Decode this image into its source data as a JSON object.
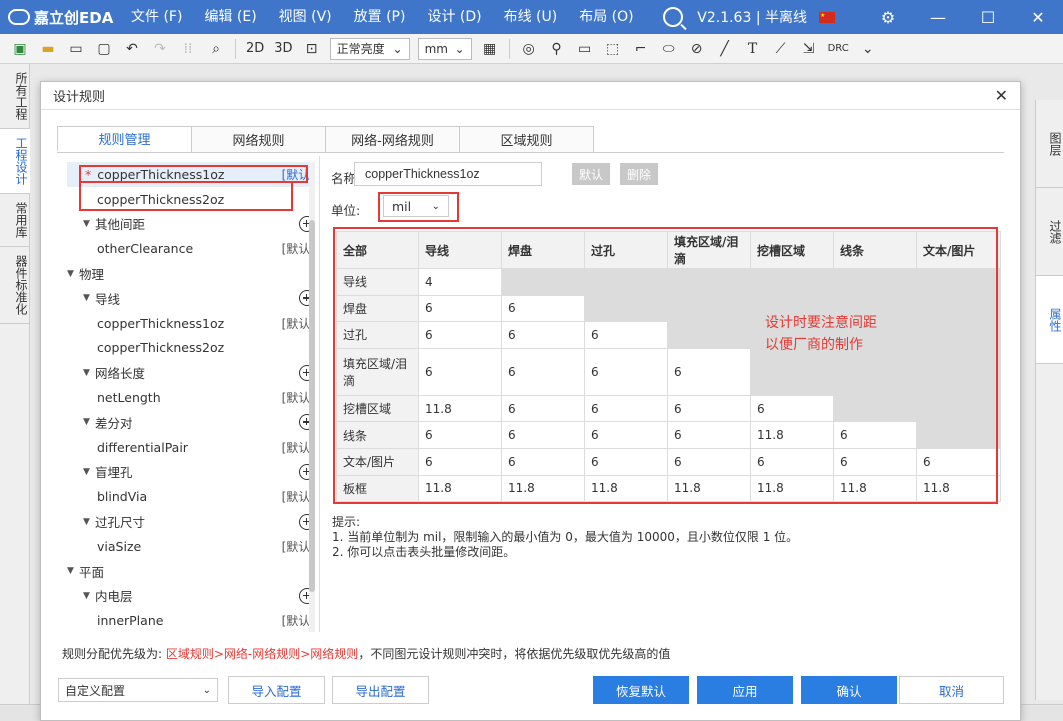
{
  "app": {
    "logo_text": "嘉立创EDA",
    "menu": [
      "文件 (F)",
      "编辑 (E)",
      "视图 (V)",
      "放置 (P)",
      "设计 (D)",
      "布线 (U)",
      "布局 (O)"
    ],
    "version": "V2.1.63 | 半离线",
    "window_controls": [
      "—",
      "☐",
      "✕"
    ]
  },
  "toolbar": {
    "text_2d": "2D",
    "text_3d": "3D",
    "brightness": "正常亮度",
    "unit": "mm",
    "drc": "DRC",
    "icons": [
      "new-icon",
      "open-icon",
      "save-icon",
      "save-all-icon",
      "undo-icon",
      "redo-icon",
      "grid-icon",
      "find-icon",
      "zoom-fit-icon",
      "target-icon",
      "pin-icon",
      "rect-icon",
      "select-icon",
      "polyline-icon",
      "ellipse-icon",
      "circle-slash-icon",
      "line-icon",
      "text-icon",
      "measure-icon",
      "import-icon"
    ]
  },
  "left_nav": [
    "所有工程",
    "工程设计",
    "常用库",
    "器件标准化"
  ],
  "right_nav": [
    "图层",
    "过滤",
    "属性"
  ],
  "dialog": {
    "title": "设计规则",
    "close": "✕",
    "tabs": [
      "规则管理",
      "网络规则",
      "网络-网络规则",
      "区域规则"
    ],
    "tree": [
      {
        "type": "item",
        "indent": 1,
        "label": "copperThickness1oz",
        "star": "*",
        "def": "[默认]",
        "blue": true,
        "selected": true
      },
      {
        "type": "item",
        "indent": 1,
        "label": "copperThickness2oz",
        "def": ""
      },
      {
        "type": "group",
        "indent": 1,
        "label": "其他间距",
        "add": true
      },
      {
        "type": "item",
        "indent": 1,
        "label": "otherClearance",
        "def": "[默认]"
      },
      {
        "type": "group",
        "indent": 0,
        "label": "物理"
      },
      {
        "type": "group",
        "indent": 1,
        "label": "导线",
        "add": true
      },
      {
        "type": "item",
        "indent": 1,
        "label": "copperThickness1oz",
        "def": "[默认]"
      },
      {
        "type": "item",
        "indent": 1,
        "label": "copperThickness2oz",
        "def": ""
      },
      {
        "type": "group",
        "indent": 1,
        "label": "网络长度",
        "add": true
      },
      {
        "type": "item",
        "indent": 1,
        "label": "netLength",
        "def": "[默认]"
      },
      {
        "type": "group",
        "indent": 1,
        "label": "差分对",
        "add": true
      },
      {
        "type": "item",
        "indent": 1,
        "label": "differentialPair",
        "def": "[默认]"
      },
      {
        "type": "group",
        "indent": 1,
        "label": "盲埋孔",
        "add": true
      },
      {
        "type": "item",
        "indent": 1,
        "label": "blindVia",
        "def": "[默认]"
      },
      {
        "type": "group",
        "indent": 1,
        "label": "过孔尺寸",
        "add": true
      },
      {
        "type": "item",
        "indent": 1,
        "label": "viaSize",
        "def": "[默认]"
      },
      {
        "type": "group",
        "indent": 0,
        "label": "平面"
      },
      {
        "type": "group",
        "indent": 1,
        "label": "内电层",
        "add": true
      },
      {
        "type": "item",
        "indent": 1,
        "label": "innerPlane",
        "def": "[默认]"
      }
    ],
    "name_label": "名称:",
    "name_value": "copperThickness1oz",
    "btn_default": "默认",
    "btn_delete": "删除",
    "unit_label": "单位:",
    "unit_value": "mil",
    "table": {
      "headers": [
        "全部",
        "导线",
        "焊盘",
        "过孔",
        "填充区域/泪滴",
        "挖槽区域",
        "线条",
        "文本/图片"
      ],
      "rows": [
        {
          "name": "导线",
          "values": [
            "4"
          ]
        },
        {
          "name": "焊盘",
          "values": [
            "6",
            "6"
          ]
        },
        {
          "name": "过孔",
          "values": [
            "6",
            "6",
            "6"
          ]
        },
        {
          "name": "填充区域/泪滴",
          "values": [
            "6",
            "6",
            "6",
            "6"
          ]
        },
        {
          "name": "挖槽区域",
          "values": [
            "11.8",
            "6",
            "6",
            "6",
            "6"
          ]
        },
        {
          "name": "线条",
          "values": [
            "6",
            "6",
            "6",
            "6",
            "11.8",
            "6"
          ]
        },
        {
          "name": "文本/图片",
          "values": [
            "6",
            "6",
            "6",
            "6",
            "6",
            "6",
            "6"
          ]
        },
        {
          "name": "板框",
          "values": [
            "11.8",
            "11.8",
            "11.8",
            "11.8",
            "11.8",
            "11.8",
            "11.8"
          ]
        }
      ]
    },
    "annotation": "设计时要注意间距以便厂商的制作",
    "tips_title": "提示:",
    "tip1": "1. 当前单位制为 mil，限制输入的最小值为 0，最大值为 10000，且小数位仅限 1 位。",
    "tip2": "2. 你可以点击表头批量修改间距。",
    "priority_prefix": "规则分配优先级为: ",
    "priority_order": "区域规则>网络-网络规则>网络规则",
    "priority_suffix": "，不同图元设计规则冲突时，将依据优先级取优先级高的值",
    "config_value": "自定义配置",
    "btn_import": "导入配置",
    "btn_export": "导出配置",
    "btn_restore": "恢复默认",
    "btn_apply": "应用",
    "btn_ok": "确认",
    "btn_cancel": "取消"
  },
  "colors": {
    "titlebar": "#3f76c9",
    "accent": "#2a7de1",
    "annotation_red": "#e53935"
  }
}
